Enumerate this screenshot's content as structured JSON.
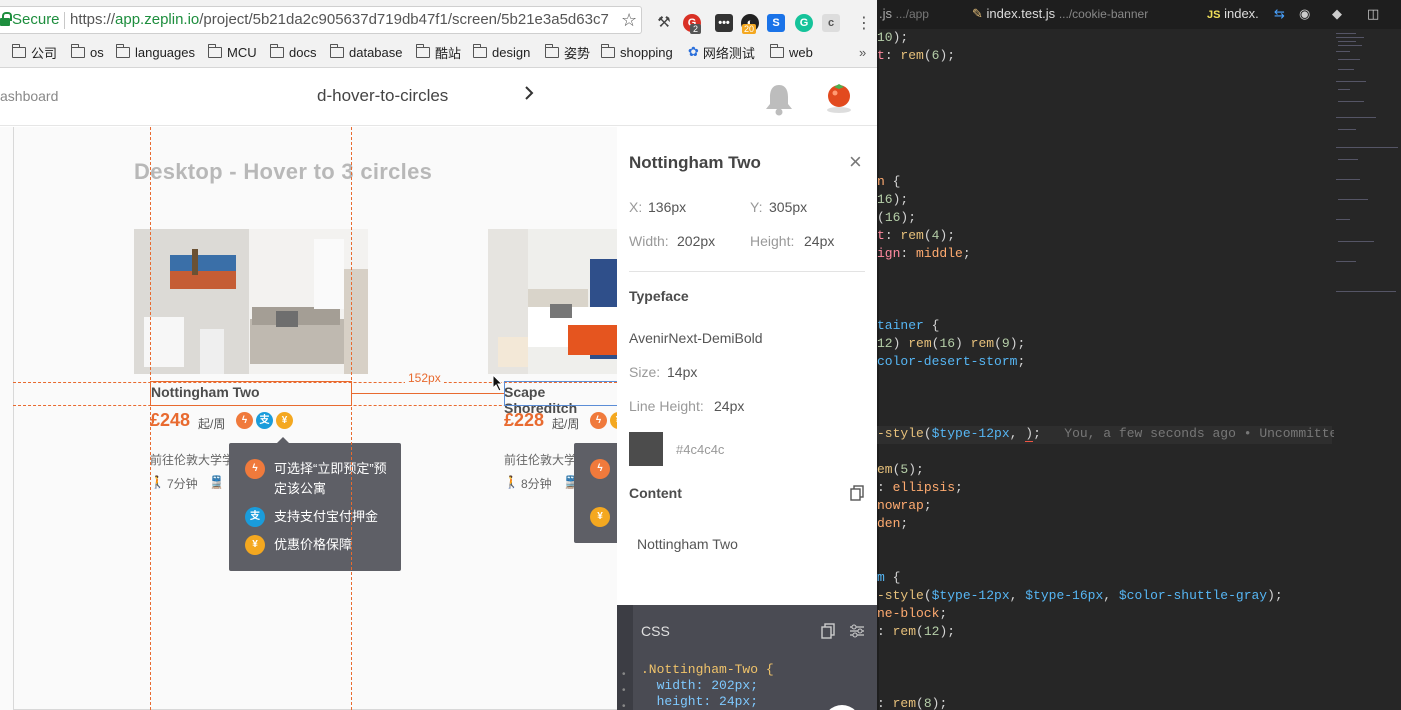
{
  "browser": {
    "secure_label": "Secure",
    "url_scheme": "https://",
    "url_host": "app.zeplin.io",
    "url_path": "/project/5b21da2c905637d719db47f1/screen/5b21e3a5d63c7...",
    "ext_badge_1": "2",
    "ext_badge_2": "20",
    "bookmarks": [
      "公司",
      "os",
      "languages",
      "MCU",
      "docs",
      "database",
      "酷站",
      "design",
      "姿势",
      "shopping",
      "网络测试",
      "web"
    ],
    "bookmarks_more": "»"
  },
  "zeplin": {
    "back_label": "ashboard",
    "screen_name": "d-hover-to-circles",
    "artboard_title": "Desktop - Hover to 3 circles",
    "distance_label": "152px",
    "cards": [
      {
        "name": "Nottingham Two",
        "price": "£248",
        "unit": "起/周",
        "uni": "前往伦敦大学学",
        "walk": "7分钟"
      },
      {
        "name": "Scape Shoreditch",
        "price": "£228",
        "unit": "起/周",
        "uni": "前往伦敦大学",
        "walk": "8分钟"
      }
    ],
    "tooltip": {
      "row1": "可选择“立即预定”预定该公寓",
      "row2": "支持支付宝付押金",
      "row3": "优惠价格保障"
    }
  },
  "inspector": {
    "layer_name": "Nottingham Two",
    "close_icon": "×",
    "x_label": "X:",
    "x_value": "136px",
    "y_label": "Y:",
    "y_value": "305px",
    "width_label": "Width:",
    "width_value": "202px",
    "height_label": "Height:",
    "height_value": "24px",
    "typeface_title": "Typeface",
    "font_name": "AvenirNext-DemiBold",
    "size_label": "Size:",
    "size_value": "14px",
    "lineheight_label": "Line Height:",
    "lineheight_value": "24px",
    "color_hex": "#4c4c4c",
    "content_title": "Content",
    "content_text": "Nottingham Two",
    "css_title": "CSS",
    "css_lines": [
      ".Nottingham-Two {",
      "  width: 202px;",
      "  height: 24px;"
    ]
  },
  "editor": {
    "tabs": [
      {
        "name": ".js",
        "path": ".../app"
      },
      {
        "name": "index.test.js",
        "path": ".../cookie-banner"
      },
      {
        "name": "index.",
        "path": ""
      }
    ],
    "blame": "You, a few seconds ago • Uncommitted"
  },
  "colors": {
    "accent": "#e86a2f",
    "swatch": "#4c4c4c",
    "editor_bg": "#262626"
  }
}
